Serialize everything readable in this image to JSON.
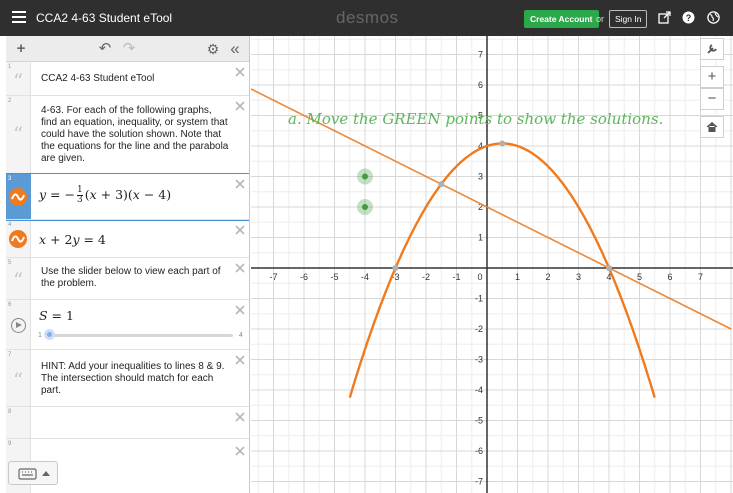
{
  "header": {
    "title": "CCA2 4-63 Student eTool",
    "brand": "desmos",
    "create_account": "Create Account",
    "or": "or",
    "sign_in": "Sign In",
    "icons": [
      "share-icon",
      "help-icon",
      "language-globe-icon"
    ]
  },
  "toolbar": {
    "add": "+",
    "undo": "↶",
    "redo": "↷",
    "settings": "⚙",
    "collapse": "«"
  },
  "expressions": [
    {
      "num": "1",
      "type": "note",
      "text": "CCA2 4-63  Student eTool"
    },
    {
      "num": "2",
      "type": "note",
      "text": "4-63.  For each of the following graphs, find an equation, inequality, or system that could have the solution shown. Note that the equations for the line and the parabola are given."
    },
    {
      "num": "3",
      "type": "math",
      "color": "#f07a1e"
    },
    {
      "num": "4",
      "type": "math",
      "color": "#f07a1e"
    },
    {
      "num": "5",
      "type": "note",
      "text": "Use the slider below to view each part of the problem."
    },
    {
      "num": "6",
      "type": "slider",
      "slider_min": "1",
      "slider_max": "4",
      "slider_value": 1
    },
    {
      "num": "7",
      "type": "note",
      "text": "HINT: Add your inequalities to lines 8 & 9. The intersection should match for each part."
    },
    {
      "num": "8",
      "type": "empty"
    },
    {
      "num": "9",
      "type": "empty"
    }
  ],
  "graph": {
    "instruction": "a. Move the GREEN points to show the solutions.",
    "x_tick_labels": [
      "-7",
      "-6",
      "-5",
      "-4",
      "-3",
      "-2",
      "-1",
      "0",
      "1",
      "2",
      "3",
      "4",
      "5",
      "6",
      "7"
    ],
    "y_tick_labels": [
      "7",
      "6",
      "5",
      "4",
      "3",
      "2",
      "1",
      "-1",
      "-2",
      "-3",
      "-4",
      "-5",
      "-6",
      "-7"
    ],
    "xlim": [
      -7.8,
      7.8
    ],
    "ylim": [
      -7.5,
      7.5
    ],
    "parabola": {
      "a": -0.3333,
      "roots": [
        -3,
        4
      ],
      "color": "#f07a1e"
    },
    "line": {
      "slope": -0.5,
      "intercept": 2,
      "color": "#f07a1e"
    },
    "green_points": [
      {
        "x": -4,
        "y": 3
      },
      {
        "x": -4,
        "y": 2
      }
    ],
    "green_color": "#3f9d3f",
    "side_buttons": [
      "wrench-icon",
      "zoom-in-icon",
      "zoom-out-icon",
      "home-icon"
    ]
  }
}
